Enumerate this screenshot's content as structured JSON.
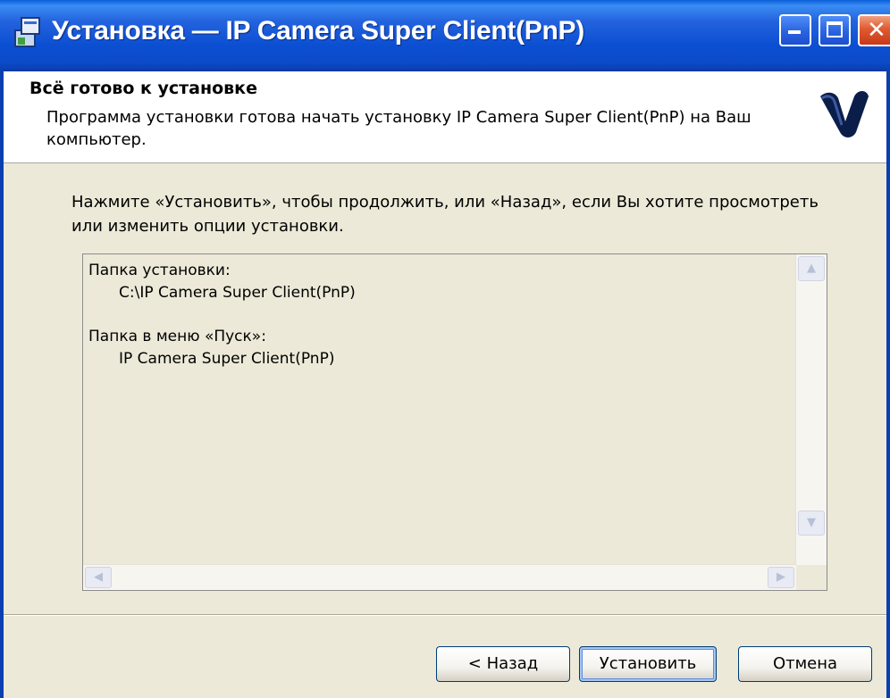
{
  "window": {
    "title": "Установка — IP Camera Super Client(PnP)",
    "icon": "installer-icon",
    "controls": [
      "minimize-icon",
      "maximize-icon",
      "close-icon"
    ],
    "close_glyph": "✕"
  },
  "header": {
    "title": "Всё готово к установке",
    "subtitle": "Программа установки готова начать установку IP Camera Super Client(PnP) на Ваш компьютер."
  },
  "main": {
    "instruction": "Нажмите «Установить», чтобы продолжить, или «Назад», если Вы хотите просмотреть или изменить опции установки.",
    "summary": {
      "install_folder_label": "Папка установки:",
      "install_folder_value": "C:\\IP Camera Super Client(PnP)",
      "start_menu_label": "Папка в меню «Пуск»:",
      "start_menu_value": "IP Camera Super Client(PnP)"
    },
    "scroll_glyphs": {
      "up": "▲",
      "down": "▼",
      "left": "◀",
      "right": "▶"
    }
  },
  "buttons": {
    "back": "< Назад",
    "install": "Установить",
    "cancel": "Отмена"
  },
  "colors": {
    "titlebar": "#0b4fd2",
    "dialog_bg": "#ece9d8",
    "header_bg": "#ffffff",
    "close_button": "#e05a30"
  }
}
